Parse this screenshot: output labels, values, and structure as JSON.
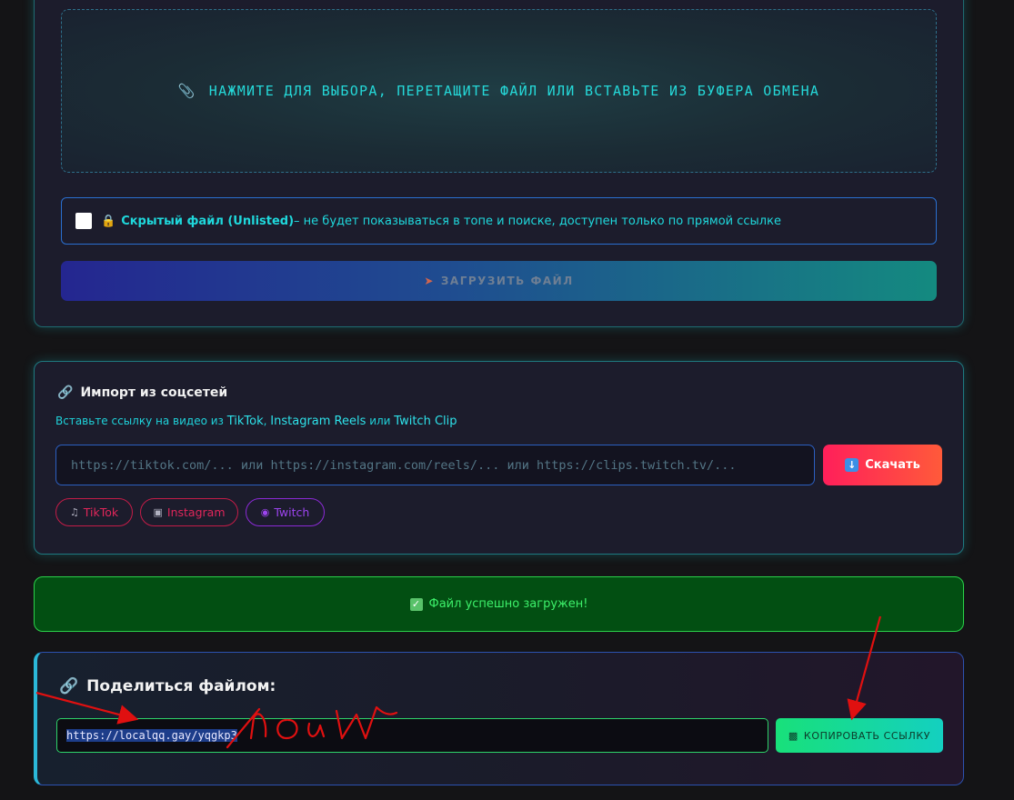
{
  "upload": {
    "dropzone_text": "НАЖМИТЕ ДЛЯ ВЫБОРА, ПЕРЕТАЩИТЕ ФАЙЛ ИЛИ ВСТАВЬТЕ ИЗ БУФЕРА ОБМЕНА",
    "dropzone_icon": "paperclip-icon",
    "unlisted_checked": false,
    "unlisted_title": "Скрытый файл (Unlisted)",
    "unlisted_desc": " – не будет показываться в топе и поиске, доступен только по прямой ссылке",
    "upload_button": "ЗАГРУЗИТЬ ФАЙЛ"
  },
  "import": {
    "title": "Импорт из соцсетей",
    "subtitle_prefix": "Вставьте ссылку на видео из ",
    "subtitle_tiktok": "TikTok",
    "subtitle_sep1": ", ",
    "subtitle_instagram": "Instagram Reels",
    "subtitle_sep2": " или ",
    "subtitle_twitch": "Twitch Clip",
    "url_placeholder": "https://tiktok.com/... или https://instagram.com/reels/... или https://clips.twitch.tv/...",
    "download_button": "Скачать",
    "platforms": [
      {
        "label": "TikTok",
        "icon": "music-note-icon"
      },
      {
        "label": "Instagram",
        "icon": "camera-icon"
      },
      {
        "label": "Twitch",
        "icon": "gamepad-icon"
      }
    ]
  },
  "success": {
    "message": "Файл успешно загружен!"
  },
  "share": {
    "title": "Поделиться файлом:",
    "url": "https://localqq.gay/yqgkp3",
    "copy_button": "КОПИРОВАТЬ ССЫЛКУ"
  },
  "annotation": {
    "handwritten_text": "/now",
    "color": "#e01010"
  },
  "colors": {
    "accent_cyan": "#1fd8dc",
    "success_green": "#3df06a",
    "danger_pink": "#ff1f5a",
    "twitch_purple": "#9c44ee"
  }
}
